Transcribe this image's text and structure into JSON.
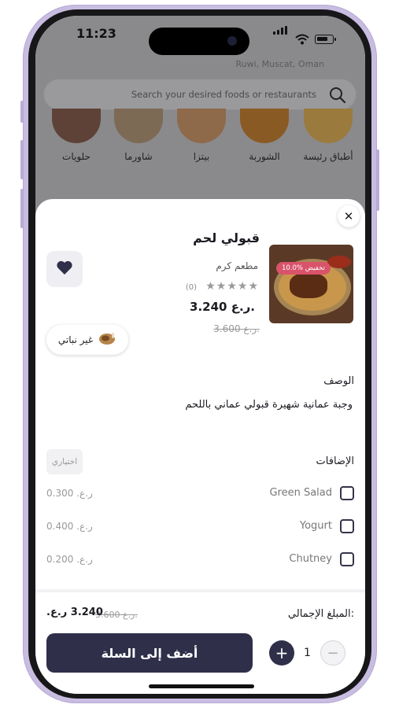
{
  "status_bar": {
    "time": "11:23"
  },
  "background": {
    "address": "Ruwi, Muscat, Oman",
    "search": {
      "placeholder": "Search your desired foods or restaurants"
    },
    "categories": [
      {
        "label": "أطباق رئيسة"
      },
      {
        "label": "الشوربة"
      },
      {
        "label": "بيتزا"
      },
      {
        "label": "شاورما"
      },
      {
        "label": "حلويات"
      }
    ]
  },
  "item": {
    "title": "قبولي لحم",
    "restaurant": "مطعم كرم",
    "rating_stars": "★★★★★",
    "rating_count": "(0)",
    "price": "3.240 ر.ع.",
    "old_price": "3.600 ر.ع.",
    "discount_badge": "10.0% تخفيض",
    "diet_tag": "غير نباتي"
  },
  "description": {
    "title": "الوصف",
    "text": "وجبة عمانية شهيرة قبولي عماني باللحم"
  },
  "addons": {
    "title": "الإضافات",
    "optional_label": "اختياري",
    "items": [
      {
        "name": "Green Salad",
        "price": "ر.ع. 0.300"
      },
      {
        "name": "Yogurt",
        "price": "ر.ع. 0.400"
      },
      {
        "name": "Chutney",
        "price": "ر.ع. 0.200"
      }
    ]
  },
  "footer": {
    "total_label": "المبلغ الإجمالي:",
    "total_price": "3.240 ر.ع.",
    "total_old_price": "3.600 ر.ع.",
    "quantity": "1",
    "add_to_cart": "أضف إلى السلة"
  },
  "colors": {
    "primary": "#2f2f4a",
    "promo": "#d9536a",
    "overlay": "#8a8a8c"
  }
}
